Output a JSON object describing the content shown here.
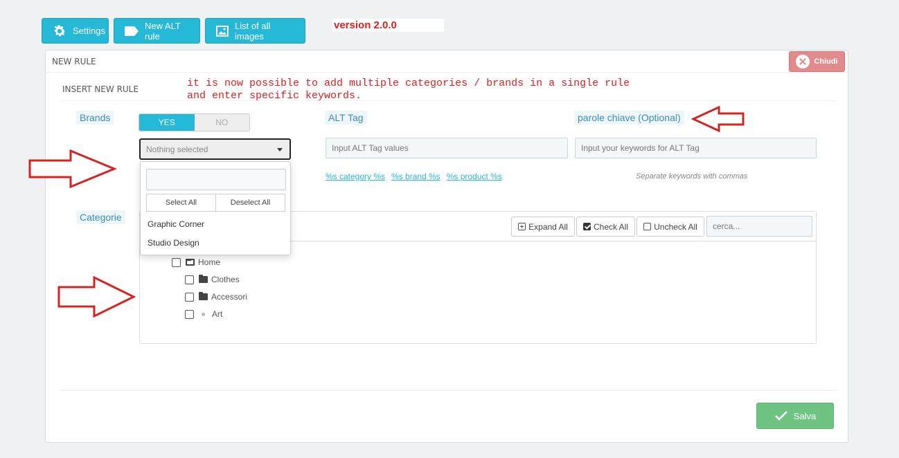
{
  "toolbar": {
    "settings_label": "Settings",
    "new_alt_rule_label": "New ALT rule",
    "list_images_label": "List of all images",
    "version": "version 2.0.0"
  },
  "panel": {
    "title": "NEW RULE",
    "close_label": "Chiudi",
    "sub_heading": "INSERT NEW RULE",
    "annotation": "it is now possible to add multiple categories / brands in a single rule\nand enter specific keywords."
  },
  "brands": {
    "label": "Brands",
    "switch_yes": "YES",
    "switch_no": "NO",
    "select_value": "Nothing selected",
    "select_all_label": "Select All",
    "deselect_all_label": "Deselect All",
    "options": [
      "Graphic Corner",
      "Studio Design"
    ]
  },
  "alt_tag": {
    "label": "ALT Tag",
    "placeholder": "Input ALT Tag values",
    "tokens": [
      "%s category %s",
      "%s brand %s",
      "%s product %s"
    ]
  },
  "keywords": {
    "label": "parole chiave (Optional)",
    "placeholder": "Input your keywords for ALT Tag",
    "help": "Separate keywords with commas"
  },
  "categories": {
    "label": "Categorie",
    "expand_all": "Expand All",
    "check_all": "Check All",
    "uncheck_all": "Uncheck All",
    "search_placeholder": "cerca...",
    "tree": [
      "Home",
      "Clothes",
      "Accessori",
      "Art"
    ]
  },
  "footer": {
    "save_label": "Salva"
  },
  "colors": {
    "primary": "#25b9d7",
    "danger": "#e28b8d",
    "success": "#70c483",
    "annotation": "#d82222"
  }
}
